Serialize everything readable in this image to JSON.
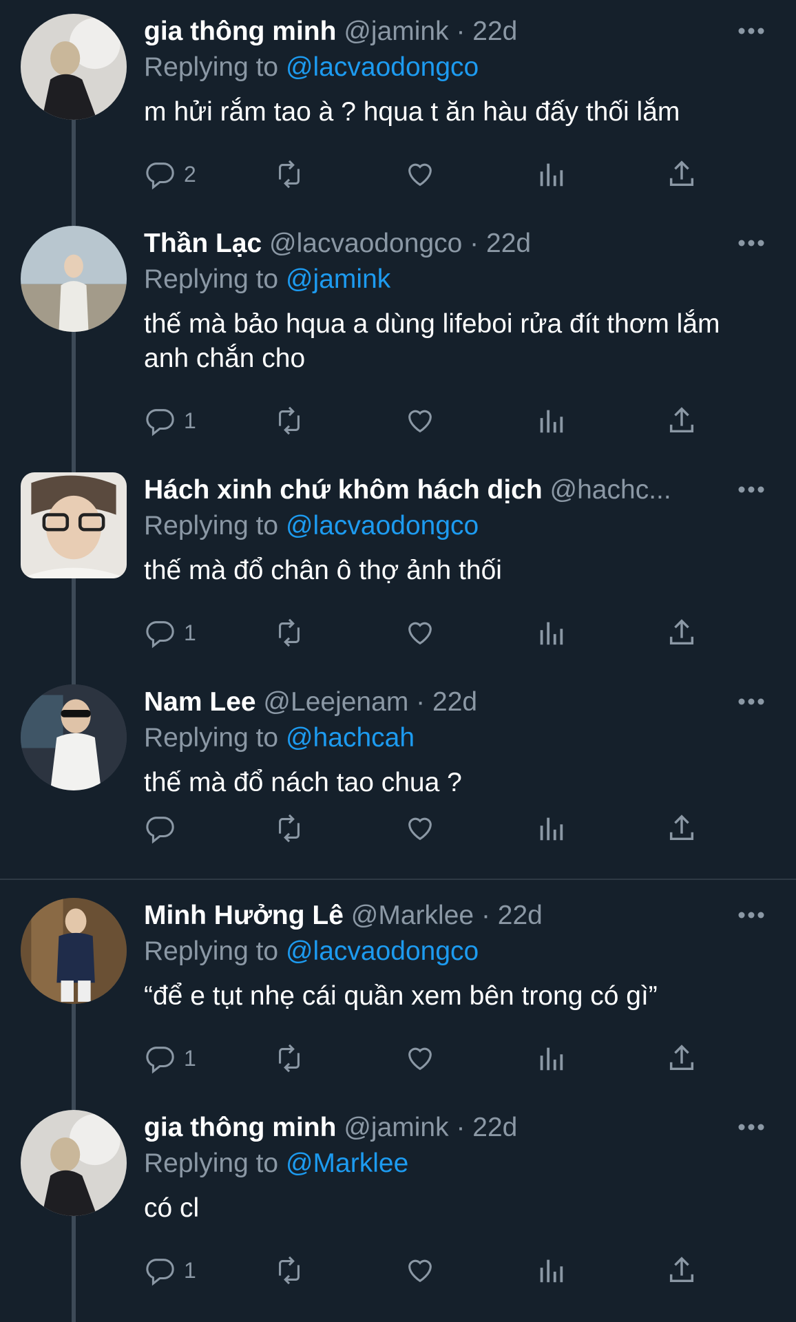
{
  "tweets": [
    {
      "name": "gia thông minh",
      "handle": "@jamink",
      "dot": "·",
      "time": "22d",
      "reply_prefix": "Replying to",
      "reply_to": "@lacvaodongco",
      "text": "m hửi rắm tao à ? hqua t ăn hàu đấy thối lắm",
      "reply_count": "2"
    },
    {
      "name": "Thần Lạc",
      "handle": "@lacvaodongco",
      "dot": "·",
      "time": "22d",
      "reply_prefix": "Replying to",
      "reply_to": "@jamink",
      "text": "thế mà bảo hqua a dùng lifeboi rửa đít thơm lắm anh chắn cho",
      "reply_count": "1"
    },
    {
      "name": "Hách xinh chứ khôm hách dịch",
      "handle": "@hachc...",
      "dot": "",
      "time": "",
      "reply_prefix": "Replying to",
      "reply_to": "@lacvaodongco",
      "text": "thế mà đổ chân ô thợ ảnh thối",
      "reply_count": "1"
    },
    {
      "name": "Nam Lee",
      "handle": "@Leejenam",
      "dot": "·",
      "time": "22d",
      "reply_prefix": "Replying to",
      "reply_to": "@hachcah",
      "text": "thế mà đổ nách tao chua ?",
      "reply_count": ""
    },
    {
      "name": "Minh Hưởng Lê",
      "handle": "@Marklee",
      "dot": "·",
      "time": "22d",
      "reply_prefix": "Replying to",
      "reply_to": "@lacvaodongco",
      "text": "“để e tụt nhẹ cái quần xem bên trong có gì”",
      "reply_count": "1"
    },
    {
      "name": "gia thông minh",
      "handle": "@jamink",
      "dot": "·",
      "time": "22d",
      "reply_prefix": "Replying to",
      "reply_to": "@Marklee",
      "text": "có cl",
      "reply_count": "1"
    }
  ],
  "icons": {
    "reply": "reply-icon",
    "retweet": "retweet-icon",
    "like": "heart-icon",
    "views": "views-icon",
    "share": "share-icon",
    "more": "more-icon"
  },
  "colors": {
    "background": "#15202b",
    "mention": "#1d9bf0",
    "muted": "#8b98a5",
    "text": "#ffffff"
  }
}
